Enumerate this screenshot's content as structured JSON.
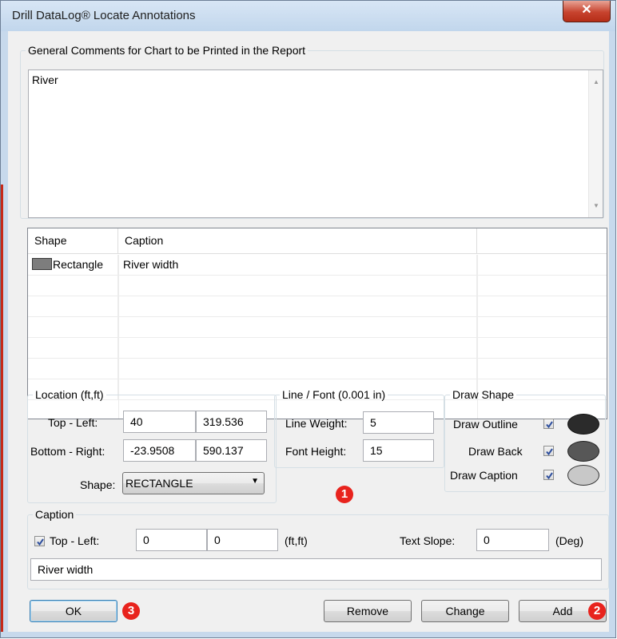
{
  "window": {
    "title": "Drill DataLog® Locate Annotations",
    "close_glyph": "✕"
  },
  "comments": {
    "legend": "General Comments for Chart to be Printed in the Report",
    "value": "River"
  },
  "grid": {
    "columns": [
      "Shape",
      "Caption",
      ""
    ],
    "rows": [
      {
        "shape": "Rectangle",
        "caption": "River width",
        "icon": "rectangle-swatch-icon"
      }
    ],
    "empty_rows": 6
  },
  "location": {
    "legend": "Location (ft,ft)",
    "top_left_label": "Top - Left:",
    "top_left_x": "40",
    "top_left_y": "319.536",
    "bottom_right_label": "Bottom - Right:",
    "bottom_right_x": "-23.9508",
    "bottom_right_y": "590.137",
    "shape_label": "Shape:",
    "shape_value": "RECTANGLE"
  },
  "line_font": {
    "legend": "Line / Font (0.001 in)",
    "line_weight_label": "Line Weight:",
    "line_weight": "5",
    "font_height_label": "Font Height:",
    "font_height": "15"
  },
  "draw_shape": {
    "legend": "Draw Shape",
    "outline_label": "Draw Outline",
    "back_label": "Draw Back",
    "caption_label": "Draw Caption",
    "outline_checked": true,
    "back_checked": true,
    "caption_checked": true,
    "colors": {
      "outline": "#2b2b2b",
      "back": "#575757",
      "caption": "#c8c8c8"
    }
  },
  "caption": {
    "legend": "Caption",
    "top_left_label": "Top - Left:",
    "top_left_checked": true,
    "x": "0",
    "y": "0",
    "units": "(ft,ft)",
    "text_slope_label": "Text Slope:",
    "text_slope": "0",
    "deg_units": "(Deg)",
    "text": "River width"
  },
  "buttons": {
    "ok": "OK",
    "remove": "Remove",
    "change": "Change",
    "add": "Add"
  },
  "badges": {
    "one": "1",
    "two": "2",
    "three": "3"
  },
  "accent": "#e8231d"
}
